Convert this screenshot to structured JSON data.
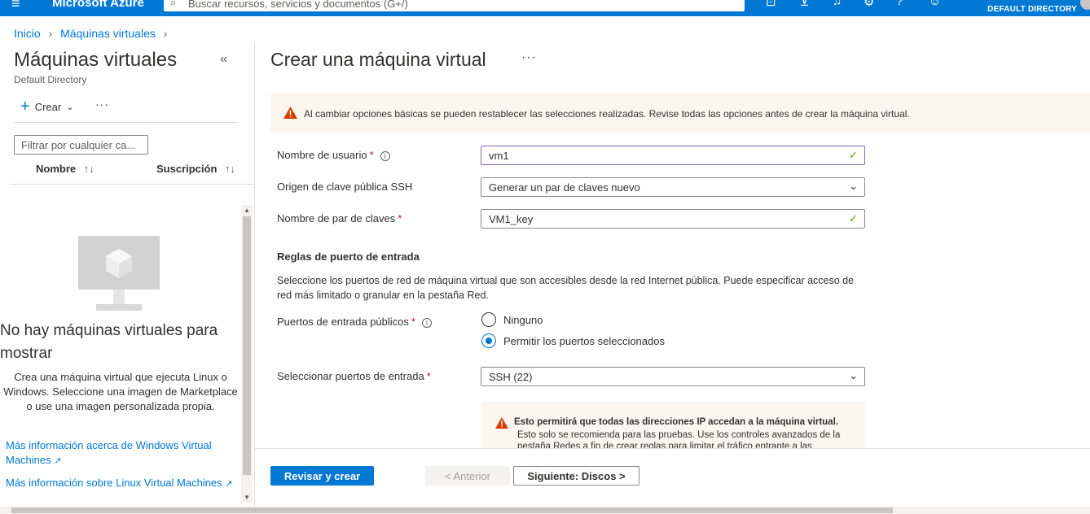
{
  "topbar": {
    "brand": "Microsoft Azure",
    "search_placeholder": "Buscar recursos, servicios y documentos (G+/)",
    "directory": "DEFAULT DIRECTORY",
    "icons": [
      "menu-icon",
      "cloud-shell-icon",
      "directory-filter-icon",
      "notifications-icon",
      "settings-icon",
      "help-icon",
      "feedback-icon"
    ]
  },
  "breadcrumb": {
    "items": [
      "Inicio",
      "Máquinas virtuales"
    ]
  },
  "left": {
    "title": "Máquinas virtuales",
    "subtitle": "Default Directory",
    "create_label": "Crear",
    "filter_placeholder": "Filtrar por cualquier ca...",
    "columns": [
      "Nombre",
      "Suscripción"
    ],
    "empty_title": "No hay máquinas virtuales para mostrar",
    "empty_desc": "Crea una máquina virtual que ejecuta Linux o Windows. Seleccione una imagen de Marketplace o use una imagen personalizada propia.",
    "link1": "Más información acerca de Windows Virtual Machines",
    "link2": "Más información sobre Linux Virtual Machines"
  },
  "main": {
    "title": "Crear una máquina virtual",
    "warning": "Al cambiar opciones básicas se pueden restablecer las selecciones realizadas. Revise todas las opciones antes de crear la máquina virtual.",
    "fields": {
      "username": {
        "label": "Nombre de usuario",
        "value": "vm1"
      },
      "ssh_source": {
        "label": "Origen de clave pública SSH",
        "value": "Generar un par de claves nuevo"
      },
      "key_pair": {
        "label": "Nombre de par de claves",
        "value": "VM1_key"
      }
    },
    "ports_section": {
      "title": "Reglas de puerto de entrada",
      "desc": "Seleccione los puertos de red de máquina virtual que son accesibles desde la red Internet pública. Puede especificar acceso de red más limitado o granular en la pestaña Red.",
      "public_ports_label": "Puertos de entrada públicos",
      "options": [
        "Ninguno",
        "Permitir los puertos seleccionados"
      ],
      "selected_option": "Permitir los puertos seleccionados",
      "select_ports_label": "Seleccionar puertos de entrada",
      "select_ports_value": "SSH (22)",
      "warn_title": "Esto permitirá que todas las direcciones IP accedan a la máquina virtual.",
      "warn_body": "Esto solo se recomienda para las pruebas.  Use los controles avanzados de la pestaña Redes a fin de crear reglas para limitar el tráfico entrante a las"
    }
  },
  "actions": {
    "review_create": "Revisar y crear",
    "previous": "< Anterior",
    "next": "Siguiente: Discos >"
  },
  "colors": {
    "accent": "#0078d4",
    "warning_bg": "#fdf6ef",
    "warning_icon": "#d83b01",
    "valid": "#57a300",
    "required": "#a4262c"
  }
}
